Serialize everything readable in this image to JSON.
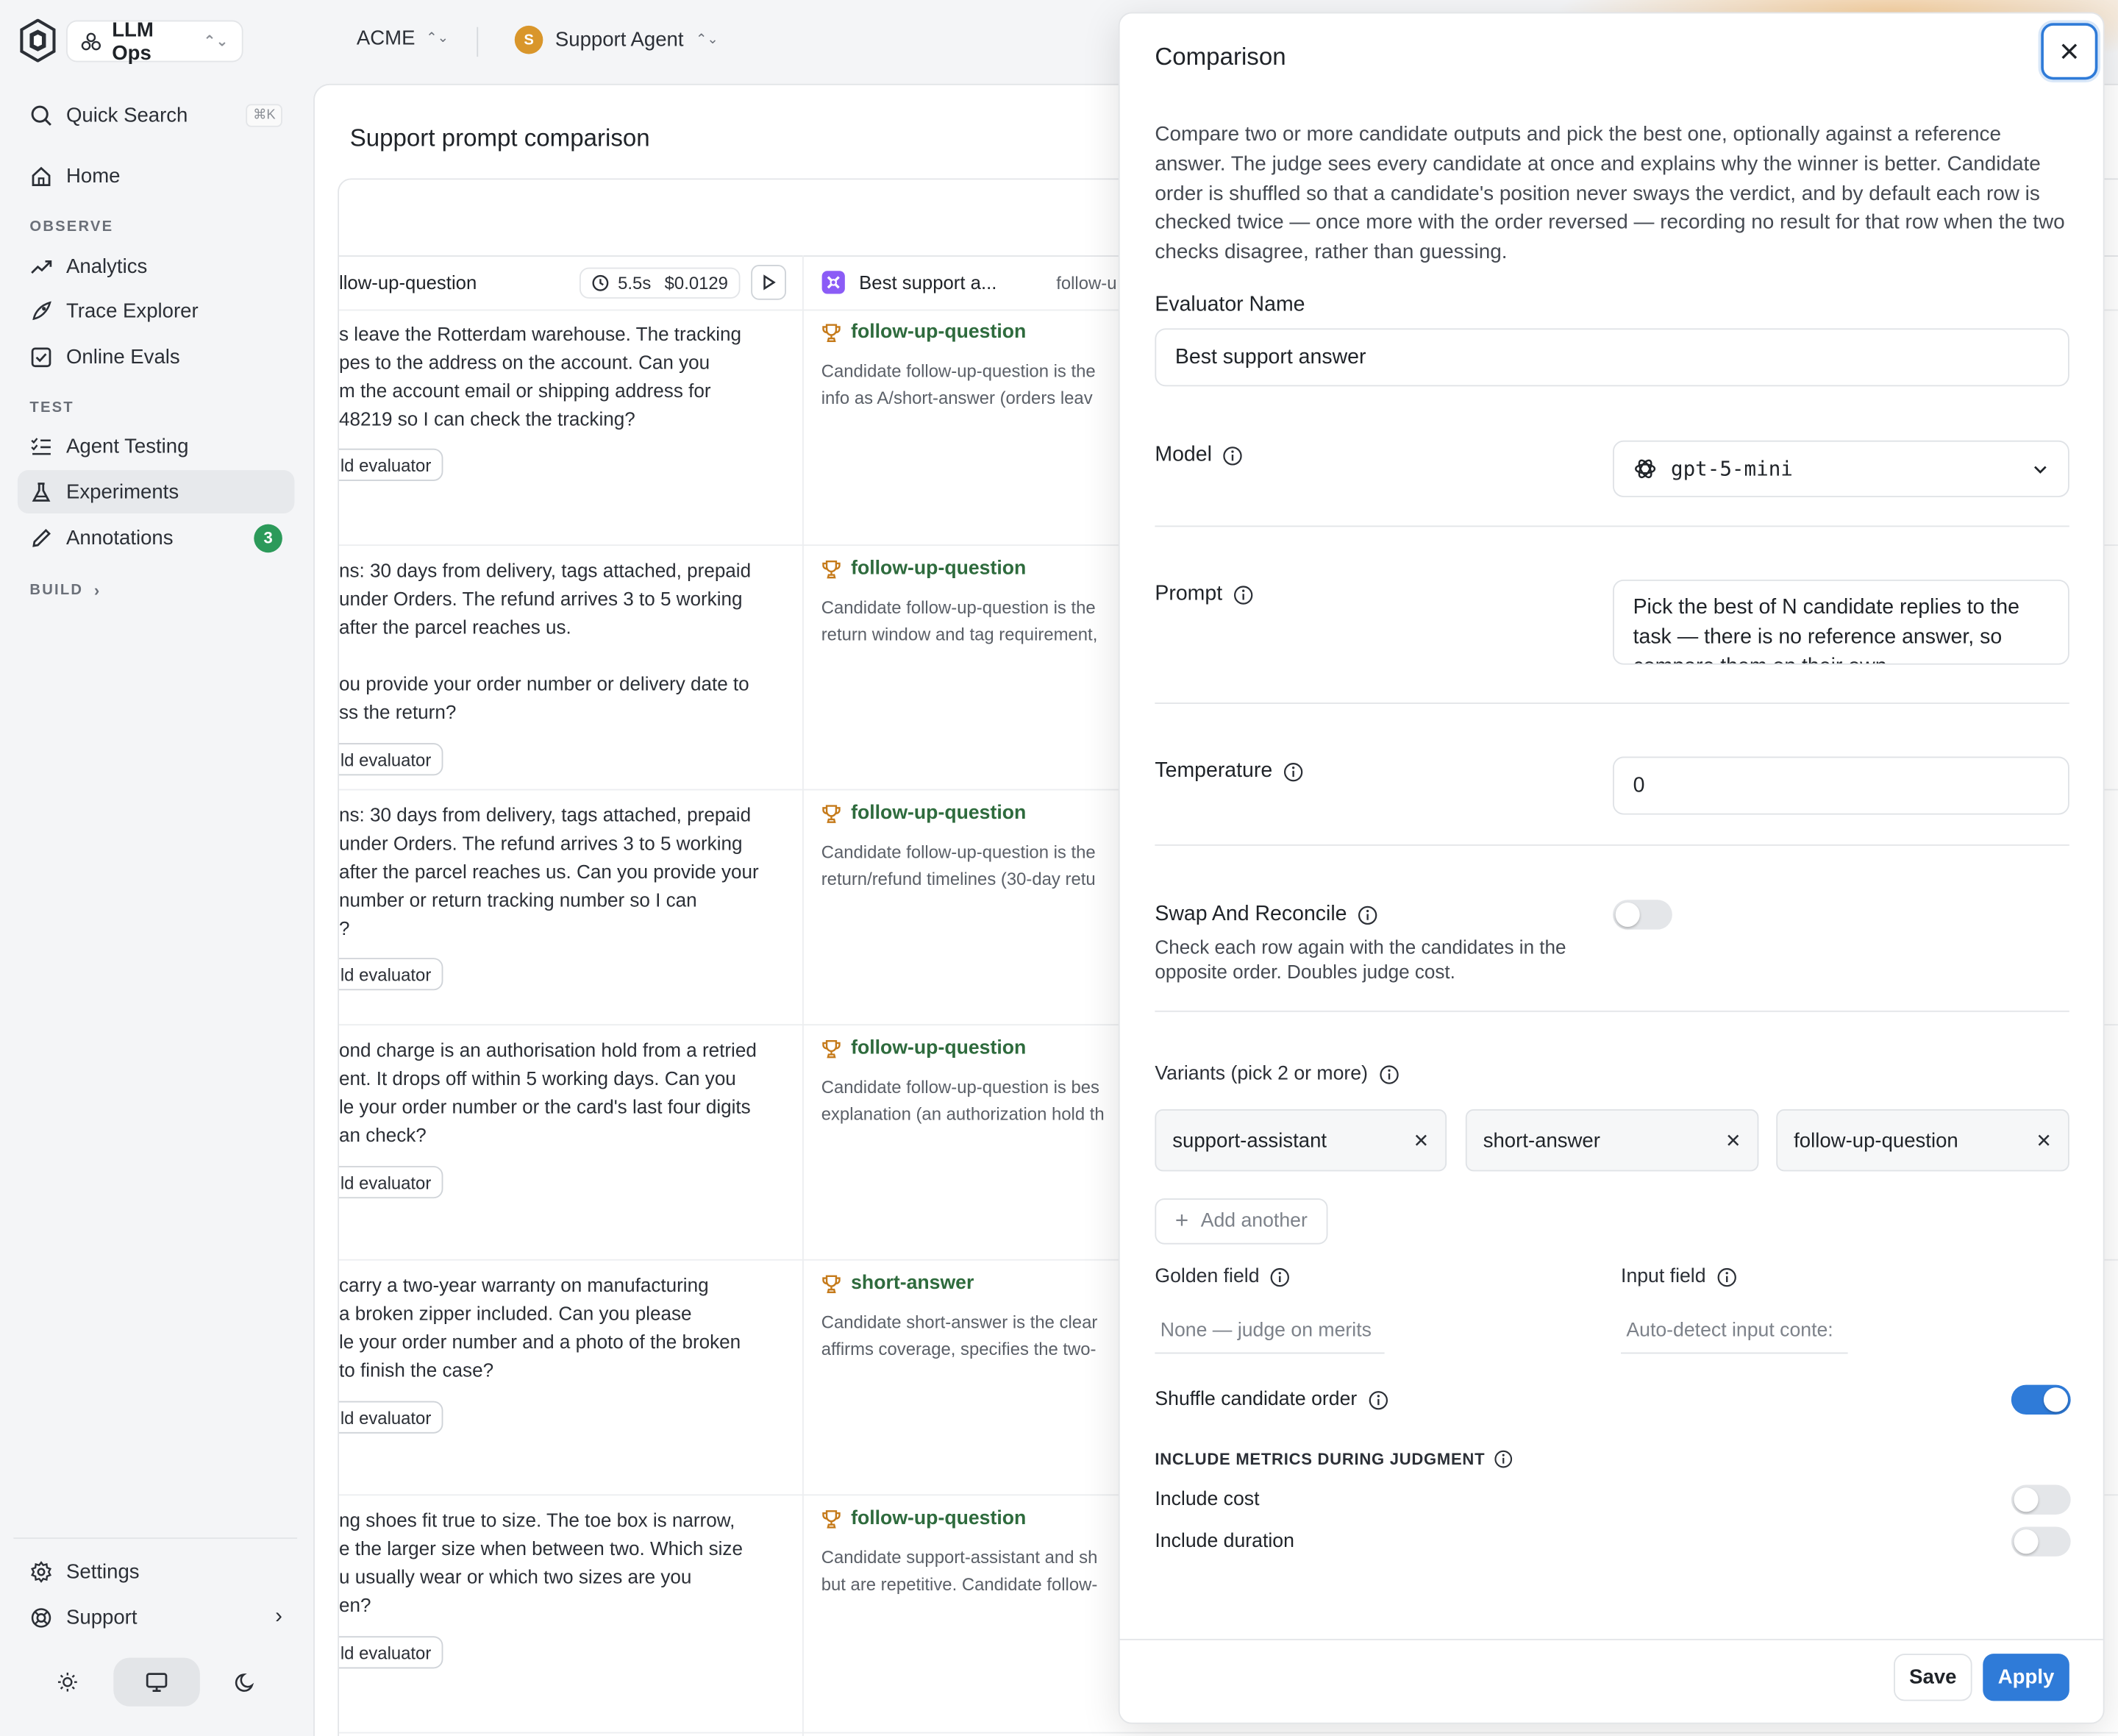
{
  "sidebar": {
    "workspace": "LLM Ops",
    "quick_search": "Quick Search",
    "shortcut": "⌘K",
    "home": "Home",
    "observe_label": "OBSERVE",
    "analytics": "Analytics",
    "trace_explorer": "Trace Explorer",
    "online_evals": "Online Evals",
    "test_label": "TEST",
    "agent_testing": "Agent Testing",
    "experiments": "Experiments",
    "annotations": "Annotations",
    "annotations_count": "3",
    "build_label": "BUILD",
    "settings": "Settings",
    "support": "Support"
  },
  "topbar": {
    "org": "ACME",
    "agent_initial": "S",
    "agent": "Support Agent"
  },
  "main": {
    "title": "Support prompt comparison",
    "col1_header": "llow-up-question",
    "col1_duration": "5.5s",
    "col1_cost": "$0.0129",
    "col2_header": "Best support a...",
    "col2_sub": "follow-u",
    "add_evaluator": "ld evaluator",
    "rows": [
      {
        "text": "s leave the Rotterdam warehouse. The tracking\npes to the address on the account. Can you\nm the account email or shipping address for\n48219 so I can check the tracking?",
        "winner": "follow-up-question",
        "reason1": "Candidate follow-up-question is the",
        "reason2": "info as A/short-answer (orders leav"
      },
      {
        "text": "ns: 30 days from delivery, tags attached, prepaid\nunder Orders. The refund arrives 3 to 5 working\nafter the parcel reaches us.\n\nou provide your order number or delivery date to\nss the return?",
        "winner": "follow-up-question",
        "reason1": "Candidate follow-up-question is the",
        "reason2": "return window and tag requirement,"
      },
      {
        "text": "ns: 30 days from delivery, tags attached, prepaid\nunder Orders. The refund arrives 3 to 5 working\nafter the parcel reaches us. Can you provide your\nnumber or return tracking number so I can\n?",
        "winner": "follow-up-question",
        "reason1": "Candidate follow-up-question is the",
        "reason2": "return/refund timelines (30-day retu"
      },
      {
        "text": "ond charge is an authorisation hold from a retried\nent. It drops off within 5 working days. Can you\nle your order number or the card's last four digits\nan check?",
        "winner": "follow-up-question",
        "reason1": "Candidate follow-up-question is bes",
        "reason2": "explanation (an authorization hold th"
      },
      {
        "text": "carry a two-year warranty on manufacturing\n a broken zipper included. Can you please\nle your order number and a photo of the broken\n to finish the case?",
        "winner": "short-answer",
        "reason1": "Candidate short-answer is the clear",
        "reason2": "affirms coverage, specifies the two-"
      },
      {
        "text": "ng shoes fit true to size. The toe box is narrow,\ne the larger size when between two. Which size\nu usually wear or which two sizes are you\nen?",
        "winner": "follow-up-question",
        "reason1": "Candidate support-assistant and sh",
        "reason2": "but are repetitive. Candidate follow-"
      }
    ]
  },
  "panel": {
    "title": "Comparison",
    "description": "Compare two or more candidate outputs and pick the best one, optionally against a reference answer. The judge sees every candidate at once and explains why the winner is better. Candidate order is shuffled so that a candidate's position never sways the verdict, and by default each row is checked twice — once more with the order reversed — recording no result for that row when the two checks disagree, rather than guessing.",
    "evaluator_name_label": "Evaluator Name",
    "evaluator_name_value": "Best support answer",
    "model_label": "Model",
    "model_value": "gpt-5-mini",
    "prompt_label": "Prompt",
    "prompt_value": "Pick the best of N candidate replies to the task — there is no reference answer, so compare them on their own",
    "temperature_label": "Temperature",
    "temperature_value": "0",
    "swap_label": "Swap And Reconcile",
    "swap_helper": "Check each row again with the candidates in the opposite order. Doubles judge cost.",
    "swap_enabled": false,
    "variants_label": "Variants (pick 2 or more)",
    "variants": [
      "support-assistant",
      "short-answer",
      "follow-up-question"
    ],
    "add_another": "Add another",
    "golden_field_label": "Golden field",
    "golden_field_placeholder": "None — judge on merits",
    "input_field_label": "Input field",
    "input_field_placeholder": "Auto-detect input conte:",
    "shuffle_label": "Shuffle candidate order",
    "shuffle_enabled": true,
    "metrics_label": "INCLUDE METRICS DURING JUDGMENT",
    "include_cost_label": "Include cost",
    "include_cost_enabled": false,
    "include_duration_label": "Include duration",
    "include_duration_enabled": false,
    "save": "Save",
    "apply": "Apply"
  },
  "colors": {
    "accent": "#2f7bd8",
    "winner_text": "#2e6b3d",
    "trophy": "#c57a1a",
    "badge": "#2c9a5a",
    "agent_avatar": "#d9962b"
  }
}
